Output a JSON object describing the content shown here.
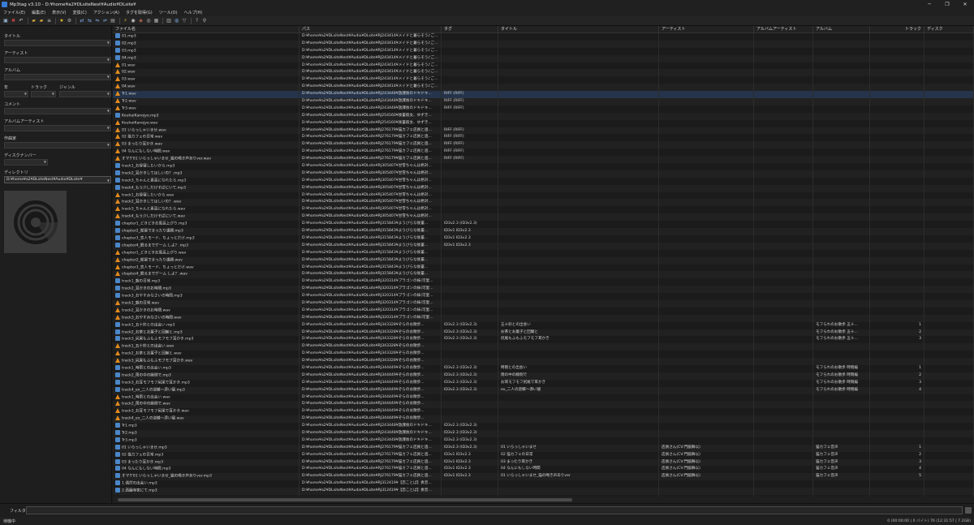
{
  "window": {
    "title": "Mp3tag v3.10 - D:¥home¥a2¥DLsiteNest¥Audio¥DLsite¥",
    "minimize": "─",
    "maximize": "❐",
    "close": "✕"
  },
  "menu": [
    "ファイル(E)",
    "編集(E)",
    "表示(V)",
    "変換(C)",
    "アクション(A)",
    "タグを取得(G)",
    "ツール(O)",
    "ヘルプ(H)"
  ],
  "toolbar": [
    {
      "icon": "save-icon",
      "glyph": "▣",
      "color": "#9ab6d8"
    },
    {
      "icon": "remove-tag-icon",
      "glyph": "✖",
      "color": "#cc4444"
    },
    {
      "icon": "undo-icon",
      "glyph": "↶",
      "color": "#cccccc"
    },
    {
      "icon": "open-folder-icon",
      "glyph": "▰",
      "color": "#e0b040"
    },
    {
      "icon": "add-folder-icon",
      "glyph": "▰",
      "color": "#e0b040"
    },
    {
      "icon": "playlist-icon",
      "glyph": "≡",
      "color": "#c8c8c8"
    },
    {
      "icon": "favorite-icon",
      "glyph": "★",
      "color": "#e8c030"
    },
    {
      "icon": "settings-icon",
      "glyph": "⚙",
      "color": "#b0b0b0"
    },
    {
      "icon": "tag-to-filename-icon",
      "glyph": "⇄",
      "color": "#7aa7e0"
    },
    {
      "icon": "filename-to-tag-icon",
      "glyph": "⇆",
      "color": "#7aa7e0"
    },
    {
      "icon": "filename-to-filename-icon",
      "glyph": "⇋",
      "color": "#7aa7e0"
    },
    {
      "icon": "tag-to-tag-icon",
      "glyph": "⇌",
      "color": "#7aa7e0"
    },
    {
      "icon": "text-file-icon",
      "glyph": "▤",
      "color": "#b0b0b0"
    },
    {
      "icon": "actions-icon",
      "glyph": "⚡",
      "color": "#e0b040"
    },
    {
      "icon": "freedb-icon",
      "glyph": "◉",
      "color": "#c8c8c8"
    },
    {
      "icon": "musicbrainz-icon",
      "glyph": "◈",
      "color": "#d07050"
    },
    {
      "icon": "discogs-icon",
      "glyph": "◎",
      "color": "#c8c8c8"
    },
    {
      "icon": "export-icon",
      "glyph": "▦",
      "color": "#b0b0b0"
    },
    {
      "icon": "playlist-export-icon",
      "glyph": "▥",
      "color": "#b0b0b0"
    },
    {
      "icon": "web-icon",
      "glyph": "◍",
      "color": "#7aa7e0"
    },
    {
      "icon": "filter-icon",
      "glyph": "▽",
      "color": "#b0b0b0"
    },
    {
      "icon": "help-icon",
      "glyph": "?",
      "color": "#b0b0b0"
    },
    {
      "icon": "search-icon",
      "glyph": "⚲",
      "color": "#c8c8c8"
    }
  ],
  "panel": {
    "title_label": "タイトル",
    "artist_label": "アーティスト",
    "album_label": "アルバム",
    "year_label": "年",
    "track_label": "トラック",
    "genre_label": "ジャンル",
    "comment_label": "コメント",
    "album_artist_label": "アルバムアーティスト",
    "composer_label": "作曲家",
    "discnumber_label": "ディスクナンバー",
    "directory_label": "ディレクトリ",
    "directory_value": "D:¥home¥a2¥DLsiteNest¥Audio¥DLsite¥"
  },
  "columns": [
    "ファイル名",
    "パス",
    "タグ",
    "タイトル",
    "アーティスト",
    "アルバムアーティスト",
    "アルバム",
    "トラック",
    "ディスク"
  ],
  "rows": [
    [
      "mp3",
      "01.mp3",
      "D:¥home¥a2¥DLsiteNest¥Audio¥DLsite¥RJ243414¥メイドと暮らそう♪ご...",
      "",
      "",
      "",
      "",
      "",
      ""
    ],
    [
      "mp3",
      "02.mp3",
      "D:¥home¥a2¥DLsiteNest¥Audio¥DLsite¥RJ243414¥メイドと暮らそう♪ご...",
      "",
      "",
      "",
      "",
      "",
      ""
    ],
    [
      "mp3",
      "03.mp3",
      "D:¥home¥a2¥DLsiteNest¥Audio¥DLsite¥RJ243414¥メイドと暮らそう♪ご...",
      "",
      "",
      "",
      "",
      "",
      ""
    ],
    [
      "mp3",
      "04.mp3",
      "D:¥home¥a2¥DLsiteNest¥Audio¥DLsite¥RJ243414¥メイドと暮らそう♪ご...",
      "",
      "",
      "",
      "",
      "",
      ""
    ],
    [
      "wav",
      "01.wav",
      "D:¥home¥a2¥DLsiteNest¥Audio¥DLsite¥RJ243414¥メイドと暮らそう♪ご...",
      "",
      "",
      "",
      "",
      "",
      ""
    ],
    [
      "wav",
      "02.wav",
      "D:¥home¥a2¥DLsiteNest¥Audio¥DLsite¥RJ243414¥メイドと暮らそう♪ご...",
      "",
      "",
      "",
      "",
      "",
      ""
    ],
    [
      "wav",
      "03.wav",
      "D:¥home¥a2¥DLsiteNest¥Audio¥DLsite¥RJ243414¥メイドと暮らそう♪ご...",
      "",
      "",
      "",
      "",
      "",
      ""
    ],
    [
      "wav",
      "04.wav",
      "D:¥home¥a2¥DLsiteNest¥Audio¥DLsite¥RJ243414¥メイドと暮らそう♪ご...",
      "",
      "",
      "",
      "",
      "",
      ""
    ],
    [
      "wav",
      "Tr1.wav",
      "D:¥home¥a2¥DLsiteNest¥Audio¥DLsite¥RJ243448¥放課後のドキドキ...",
      "RIFF (RIFF)",
      "",
      "",
      "",
      "",
      ""
    ],
    [
      "wav",
      "Tr2.wav",
      "D:¥home¥a2¥DLsiteNest¥Audio¥DLsite¥RJ243448¥放課後のドキドキ...",
      "RIFF (RIFF)",
      "",
      "",
      "",
      "",
      ""
    ],
    [
      "wav",
      "Tr3.wav",
      "D:¥home¥a2¥DLsiteNest¥Audio¥DLsite¥RJ243448¥放課後のドキドキ...",
      "RIFF (RIFF)",
      "",
      "",
      "",
      "",
      ""
    ],
    [
      "mp3",
      "KouhaiKanojyo.mp3",
      "D:¥home¥a2¥DLsiteNest¥Audio¥DLsite¥RJ254160¥後輩彼女、ゆずき...",
      "",
      "",
      "",
      "",
      "",
      ""
    ],
    [
      "wav",
      "KouhaiKanojyo.wav",
      "D:¥home¥a2¥DLsiteNest¥Audio¥DLsite¥RJ254160¥後輩彼女、ゆずき...",
      "",
      "",
      "",
      "",
      "",
      ""
    ],
    [
      "wav",
      "01 いらっしゃいませ.wav",
      "D:¥home¥a2¥DLsiteNest¥Audio¥DLsite¥RJ276179¥猫カフェ店員と過...",
      "RIFF (RIFF)",
      "",
      "",
      "",
      "",
      ""
    ],
    [
      "wav",
      "02 猫カフェの日常.wav",
      "D:¥home¥a2¥DLsiteNest¥Audio¥DLsite¥RJ276179¥猫カフェ店員と過...",
      "RIFF (RIFF)",
      "",
      "",
      "",
      "",
      ""
    ],
    [
      "wav",
      "03 まったり耳かき.wav",
      "D:¥home¥a2¥DLsiteNest¥Audio¥DLsite¥RJ276179¥猫カフェ店員と過...",
      "RIFF (RIFF)",
      "",
      "",
      "",
      "",
      ""
    ],
    [
      "wav",
      "04 なんにもしない時間.wav",
      "D:¥home¥a2¥DLsiteNest¥Audio¥DLsite¥RJ276179¥猫カフェ店員と過...",
      "RIFF (RIFF)",
      "",
      "",
      "",
      "",
      ""
    ],
    [
      "wav",
      "オマケ01 いらっしゃいませ_猫の鳴き声ありver.wav",
      "D:¥home¥a2¥DLsiteNest¥Audio¥DLsite¥RJ276179¥猫カフェ店員と過...",
      "RIFF (RIFF)",
      "",
      "",
      "",
      "",
      ""
    ],
    [
      "mp3",
      "track1_お昼寝したいから.mp3",
      "D:¥home¥a2¥DLsiteNest¥Audio¥DLsite¥RJ305407¥甘雪ちゃんは絶対...",
      "",
      "",
      "",
      "",
      "",
      ""
    ],
    [
      "mp3",
      "track2_耳かきしてほしいの？.mp3",
      "D:¥home¥a2¥DLsiteNest¥Audio¥DLsite¥RJ305407¥甘雪ちゃんは絶対...",
      "",
      "",
      "",
      "",
      "",
      ""
    ],
    [
      "mp3",
      "track3_ちゃんと素直になれたら.mp3",
      "D:¥home¥a2¥DLsiteNest¥Audio¥DLsite¥RJ305407¥甘雪ちゃんは絶対...",
      "",
      "",
      "",
      "",
      "",
      ""
    ],
    [
      "mp3",
      "track4_もう少しだけそばにいて.mp3",
      "D:¥home¥a2¥DLsiteNest¥Audio¥DLsite¥RJ305407¥甘雪ちゃんは絶対...",
      "",
      "",
      "",
      "",
      "",
      ""
    ],
    [
      "wav",
      "track1_お昼寝したいから.wav",
      "D:¥home¥a2¥DLsiteNest¥Audio¥DLsite¥RJ305407¥甘雪ちゃんは絶対...",
      "",
      "",
      "",
      "",
      "",
      ""
    ],
    [
      "wav",
      "track2_耳かきしてほしいの？.wav",
      "D:¥home¥a2¥DLsiteNest¥Audio¥DLsite¥RJ305407¥甘雪ちゃんは絶対...",
      "",
      "",
      "",
      "",
      "",
      ""
    ],
    [
      "wav",
      "track3_ちゃんと素直になれたら.wav",
      "D:¥home¥a2¥DLsiteNest¥Audio¥DLsite¥RJ305407¥甘雪ちゃんは絶対...",
      "",
      "",
      "",
      "",
      "",
      ""
    ],
    [
      "wav",
      "track4_もう少しだけそばにいて.wav",
      "D:¥home¥a2¥DLsiteNest¥Audio¥DLsite¥RJ305407¥甘雪ちゃんは絶対...",
      "",
      "",
      "",
      "",
      "",
      ""
    ],
    [
      "mp3",
      "chapter1_どきどきお風呂上がり.mp3",
      "D:¥home¥a2¥DLsiteNest¥Audio¥DLsite¥RJ315843¥ようびらな後輩...",
      "ID3v2.3 (ID3v2.3)",
      "",
      "",
      "",
      "",
      ""
    ],
    [
      "mp3",
      "chapter2_部屋でまったり課題.mp3",
      "D:¥home¥a2¥DLsiteNest¥Audio¥DLsite¥RJ315843¥ようびらな後輩...",
      "ID3v1 ID3v2.3",
      "",
      "",
      "",
      "",
      ""
    ],
    [
      "mp3",
      "chapter3_恋人モード、ちょっとだけ.mp3",
      "D:¥home¥a2¥DLsiteNest¥Audio¥DLsite¥RJ315843¥ようびらな後輩...",
      "ID3v1 ID3v2.3",
      "",
      "",
      "",
      "",
      ""
    ],
    [
      "mp3",
      "chapter4_眠るまでゲーム しよ？.mp3",
      "D:¥home¥a2¥DLsiteNest¥Audio¥DLsite¥RJ315843¥ようびらな後輩...",
      "ID3v1 ID3v2.3",
      "",
      "",
      "",
      "",
      ""
    ],
    [
      "wav",
      "chapter1_どきどきお風呂上がり.wav",
      "D:¥home¥a2¥DLsiteNest¥Audio¥DLsite¥RJ315843¥ようびらな後輩...",
      "",
      "",
      "",
      "",
      "",
      ""
    ],
    [
      "wav",
      "chapter2_部屋でまったり課題.wav",
      "D:¥home¥a2¥DLsiteNest¥Audio¥DLsite¥RJ315843¥ようびらな後輩...",
      "",
      "",
      "",
      "",
      "",
      ""
    ],
    [
      "wav",
      "chapter3_恋人モード、ちょっとだけ.wav",
      "D:¥home¥a2¥DLsiteNest¥Audio¥DLsite¥RJ315843¥ようびらな後輩...",
      "",
      "",
      "",
      "",
      "",
      ""
    ],
    [
      "wav",
      "chapter4_眠るまでゲーム しよ？.wav",
      "D:¥home¥a2¥DLsiteNest¥Audio¥DLsite¥RJ315843¥ようびらな後輩...",
      "",
      "",
      "",
      "",
      "",
      ""
    ],
    [
      "mp3",
      "track1_朝の日常.mp3",
      "D:¥home¥a2¥DLsiteNest¥Audio¥DLsite¥RJ320314¥プラゴンの妹(可愛...",
      "",
      "",
      "",
      "",
      "",
      ""
    ],
    [
      "mp3",
      "track2_耳かきのお時間.mp3",
      "D:¥home¥a2¥DLsiteNest¥Audio¥DLsite¥RJ320314¥プラゴンの妹(可愛...",
      "",
      "",
      "",
      "",
      "",
      ""
    ],
    [
      "mp3",
      "track3_おやすみなさいの時間.mp3",
      "D:¥home¥a2¥DLsiteNest¥Audio¥DLsite¥RJ320314¥プラゴンの妹(可愛...",
      "",
      "",
      "",
      "",
      "",
      ""
    ],
    [
      "wav",
      "track1_朝の日常.wav",
      "D:¥home¥a2¥DLsiteNest¥Audio¥DLsite¥RJ320314¥プラゴンの妹(可愛...",
      "",
      "",
      "",
      "",
      "",
      ""
    ],
    [
      "wav",
      "track2_耳かきのお時間.wav",
      "D:¥home¥a2¥DLsiteNest¥Audio¥DLsite¥RJ320314¥プラゴンの妹(可愛...",
      "",
      "",
      "",
      "",
      "",
      ""
    ],
    [
      "wav",
      "track3_おやすみなさいの時間.wav",
      "D:¥home¥a2¥DLsiteNest¥Audio¥DLsite¥RJ320314¥プラゴンの妹(可愛...",
      "",
      "",
      "",
      "",
      "",
      ""
    ],
    [
      "mp3",
      "track1_五十鈴との出会い.mp3",
      "D:¥home¥a2¥DLsiteNest¥Audio¥DLsite¥RJ343328¥ぞらのお散歩...",
      "ID3v2.3 (ID3v2.3)",
      "五十鈴との出会い",
      "",
      "",
      "モフられのお散歩 五十...",
      "1"
    ],
    [
      "mp3",
      "track2_お茶とお菓子と団欒と.mp3",
      "D:¥home¥a2¥DLsiteNest¥Audio¥DLsite¥RJ343328¥ぞらのお散歩...",
      "ID3v2.3 (ID3v2.3)",
      "お茶とお菓子と団欒と",
      "",
      "",
      "モフられのお散歩 五十...",
      "2"
    ],
    [
      "mp3",
      "track3_尻尾もふもふモフモフ耳かき.mp3",
      "D:¥home¥a2¥DLsiteNest¥Audio¥DLsite¥RJ343328¥ぞらのお散歩...",
      "ID3v2.3 (ID3v2.3)",
      "尻尾もふもふモフモフ耳かき",
      "",
      "",
      "モフられのお散歩 五十...",
      "3"
    ],
    [
      "wav",
      "track1_五十鈴との出会い.wav",
      "D:¥home¥a2¥DLsiteNest¥Audio¥DLsite¥RJ343328¥ぞらのお散歩...",
      "",
      "",
      "",
      "",
      "",
      ""
    ],
    [
      "wav",
      "track2_お茶とお菓子と団欒と.wav",
      "D:¥home¥a2¥DLsiteNest¥Audio¥DLsite¥RJ343328¥ぞらのお散歩...",
      "",
      "",
      "",
      "",
      "",
      ""
    ],
    [
      "wav",
      "track3_尻尾もふもふモフモフ耳かき.wav",
      "D:¥home¥a2¥DLsiteNest¥Audio¥DLsite¥RJ343328¥ぞらのお散歩...",
      "",
      "",
      "",
      "",
      "",
      ""
    ],
    [
      "mp3",
      "track1_時雨との出会い.mp3",
      "D:¥home¥a2¥DLsiteNest¥Audio¥DLsite¥RJ344449¥ぞらのお散歩...",
      "ID3v2.3 (ID3v2.3)",
      "時雨との出会い",
      "",
      "",
      "モフられのお散歩 時雨編",
      "1"
    ],
    [
      "mp3",
      "track2_雨の中の縁側で.mp3",
      "D:¥home¥a2¥DLsiteNest¥Audio¥DLsite¥RJ344449¥ぞらのお散歩...",
      "ID3v2.3 (ID3v2.3)",
      "雨の中の縁側で",
      "",
      "",
      "モフられのお散歩 時雨編",
      "2"
    ],
    [
      "mp3",
      "track3_お耳モフモフ尻尾で耳かき.mp3",
      "D:¥home¥a2¥DLsiteNest¥Audio¥DLsite¥RJ344449¥ぞらのお散歩...",
      "ID3v2.3 (ID3v2.3)",
      "お耳モフモフ尻尾で耳かき",
      "",
      "",
      "モフられのお散歩 時雨編",
      "3"
    ],
    [
      "mp3",
      "track4_ex_二人の逆鱗～添い寝.mp3",
      "D:¥home¥a2¥DLsiteNest¥Audio¥DLsite¥RJ344449¥ぞらのお散歩...",
      "ID3v2.3 (ID3v2.3)",
      "ex_二人の逆鱗～添い寝",
      "",
      "",
      "モフられのお散歩 時雨編",
      "4"
    ],
    [
      "wav",
      "track1_時雨との出会い.wav",
      "D:¥home¥a2¥DLsiteNest¥Audio¥DLsite¥RJ344449¥ぞらのお散歩...",
      "",
      "",
      "",
      "",
      "",
      ""
    ],
    [
      "wav",
      "track2_雨の中の縁側で.wav",
      "D:¥home¥a2¥DLsiteNest¥Audio¥DLsite¥RJ344449¥ぞらのお散歩...",
      "",
      "",
      "",
      "",
      "",
      ""
    ],
    [
      "wav",
      "track3_お耳モフモフ尻尾で耳かき.wav",
      "D:¥home¥a2¥DLsiteNest¥Audio¥DLsite¥RJ344449¥ぞらのお散歩...",
      "",
      "",
      "",
      "",
      "",
      ""
    ],
    [
      "wav",
      "track4_ex_二人の逆鱗～添い寝.wav",
      "D:¥home¥a2¥DLsiteNest¥Audio¥DLsite¥RJ344449¥ぞらのお散歩...",
      "",
      "",
      "",
      "",
      "",
      ""
    ],
    [
      "mp3",
      "Tr1.mp3",
      "D:¥home¥a2¥DLsiteNest¥Audio¥DLsite¥RJ243448¥放課後のドキドキ...",
      "ID3v2.3 (ID3v2.3)",
      "",
      "",
      "",
      "",
      ""
    ],
    [
      "mp3",
      "Tr2.mp3",
      "D:¥home¥a2¥DLsiteNest¥Audio¥DLsite¥RJ243448¥放課後のドキドキ...",
      "ID3v2.3 (ID3v2.3)",
      "",
      "",
      "",
      "",
      ""
    ],
    [
      "mp3",
      "Tr3.mp3",
      "D:¥home¥a2¥DLsiteNest¥Audio¥DLsite¥RJ243448¥放課後のドキドキ...",
      "ID3v2.3 (ID3v2.3)",
      "",
      "",
      "",
      "",
      ""
    ],
    [
      "mp3",
      "01 いらっしゃいませ.mp3",
      "D:¥home¥a2¥DLsiteNest¥Audio¥DLsite¥RJ276179¥猫カフェ店員と過...",
      "ID3v2.3 (ID3v2.3)",
      "01 いらっしゃいませ",
      "店員さん(CV:門脇舞以)",
      "",
      "猫カフェ音声",
      "1"
    ],
    [
      "mp3",
      "02 猫カフェの日常.mp3",
      "D:¥home¥a2¥DLsiteNest¥Audio¥DLsite¥RJ276179¥猫カフェ店員と過...",
      "ID3v1 ID3v2.3",
      "02 猫カフェの日常",
      "店員さん(CV:門脇舞以)",
      "",
      "猫カフェ音声",
      "2"
    ],
    [
      "mp3",
      "03 まったり耳かき.mp3",
      "D:¥home¥a2¥DLsiteNest¥Audio¥DLsite¥RJ276179¥猫カフェ店員と過...",
      "ID3v1 ID3v2.3",
      "03 まったり耳かき",
      "店員さん(CV:門脇舞以)",
      "",
      "猫カフェ音声",
      "3"
    ],
    [
      "mp3",
      "04 なんにもしない時間.mp3",
      "D:¥home¥a2¥DLsiteNest¥Audio¥DLsite¥RJ276179¥猫カフェ店員と過...",
      "ID3v1 ID3v2.3",
      "04 なんにもしない時間",
      "店員さん(CV:門脇舞以)",
      "",
      "猫カフェ音声",
      "4"
    ],
    [
      "mp3",
      "オマケ01 いらっしゃいませ_猫の鳴き声ありver.mp3",
      "D:¥home¥a2¥DLsiteNest¥Audio¥DLsite¥RJ276179¥猫カフェ店員と過...",
      "ID3v1 ID3v2.3",
      "01 いらっしゃいませ_猫の鳴き声ありver",
      "店員さん(CV:門脇舞以)",
      "",
      "猫カフェ音声",
      "5"
    ],
    [
      "mp3",
      "1.偶然の出会い.mp3",
      "D:¥home¥a2¥DLsiteNest¥Audio¥DLsite¥RJ312419¥【恋ことば】奏音...",
      "",
      "",
      "",
      "",
      "",
      ""
    ],
    [
      "mp3",
      "2.西園寺家にて.mp3",
      "D:¥home¥a2¥DLsiteNest¥Audio¥DLsite¥RJ312419¥【恋ことば】奏音...",
      "",
      "",
      "",
      "",
      "",
      ""
    ]
  ],
  "selected_row": 8,
  "filter_label": "フィルタ:",
  "status_left": "待機中",
  "status_right": "0 (00:00:00 | 0 バイト)    76 (12:31:57 | 7.2GB)"
}
